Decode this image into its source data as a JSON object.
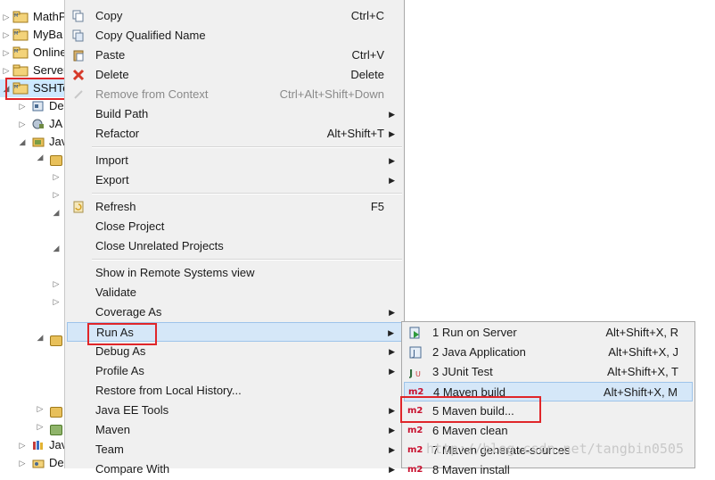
{
  "tree": {
    "projects": [
      {
        "label": "MathP"
      },
      {
        "label": "MyBa"
      },
      {
        "label": "Online"
      },
      {
        "label": "Server"
      },
      {
        "label": "SSHTe"
      }
    ],
    "children": [
      {
        "label": "De"
      },
      {
        "label": "JA"
      },
      {
        "label": "Jav"
      }
    ],
    "bottom": [
      {
        "label": "Jav"
      },
      {
        "label": "De"
      }
    ]
  },
  "menu": {
    "items": [
      {
        "label": "Copy",
        "shortcut": "Ctrl+C",
        "icon": "copy-icon"
      },
      {
        "label": "Copy Qualified Name",
        "shortcut": "",
        "icon": "copy-qualified-icon"
      },
      {
        "label": "Paste",
        "shortcut": "Ctrl+V",
        "icon": "paste-icon"
      },
      {
        "label": "Delete",
        "shortcut": "Delete",
        "icon": "delete-icon"
      },
      {
        "label": "Remove from Context",
        "shortcut": "Ctrl+Alt+Shift+Down",
        "icon": "remove-context-icon"
      },
      {
        "label": "Build Path",
        "shortcut": ""
      },
      {
        "label": "Refactor",
        "shortcut": "Alt+Shift+T"
      },
      {
        "label": "Import",
        "shortcut": ""
      },
      {
        "label": "Export",
        "shortcut": ""
      },
      {
        "label": "Refresh",
        "shortcut": "F5",
        "icon": "refresh-icon"
      },
      {
        "label": "Close Project",
        "shortcut": ""
      },
      {
        "label": "Close Unrelated Projects",
        "shortcut": ""
      },
      {
        "label": "Show in Remote Systems view",
        "shortcut": ""
      },
      {
        "label": "Validate",
        "shortcut": ""
      },
      {
        "label": "Coverage As",
        "shortcut": ""
      },
      {
        "label": "Run As",
        "shortcut": ""
      },
      {
        "label": "Debug As",
        "shortcut": ""
      },
      {
        "label": "Profile As",
        "shortcut": ""
      },
      {
        "label": "Restore from Local History...",
        "shortcut": ""
      },
      {
        "label": "Java EE Tools",
        "shortcut": ""
      },
      {
        "label": "Maven",
        "shortcut": ""
      },
      {
        "label": "Team",
        "shortcut": ""
      },
      {
        "label": "Compare With",
        "shortcut": ""
      }
    ]
  },
  "submenu": {
    "items": [
      {
        "label": "1 Run on Server",
        "shortcut": "Alt+Shift+X, R",
        "icon": "run-server-icon"
      },
      {
        "label": "2 Java Application",
        "shortcut": "Alt+Shift+X, J",
        "icon": "java-app-icon"
      },
      {
        "label": "3 JUnit Test",
        "shortcut": "Alt+Shift+X, T",
        "icon": "junit-icon"
      },
      {
        "label": "4 Maven build",
        "shortcut": "Alt+Shift+X, M",
        "icon": "m2-icon"
      },
      {
        "label": "5 Maven build...",
        "shortcut": "",
        "icon": "m2-icon"
      },
      {
        "label": "6 Maven clean",
        "shortcut": "",
        "icon": "m2-icon"
      },
      {
        "label": "7 Maven generate-sources",
        "shortcut": "",
        "icon": "m2-icon"
      },
      {
        "label": "8 Maven install",
        "shortcut": "",
        "icon": "m2-icon"
      }
    ],
    "m2_text": "m2"
  },
  "watermark": "http://blog.csdn.net/tangbin0505",
  "colors": {
    "highlight": "#d5e7f8",
    "annotation_red": "#e0262a",
    "menu_bg": "#f0f0f0"
  }
}
